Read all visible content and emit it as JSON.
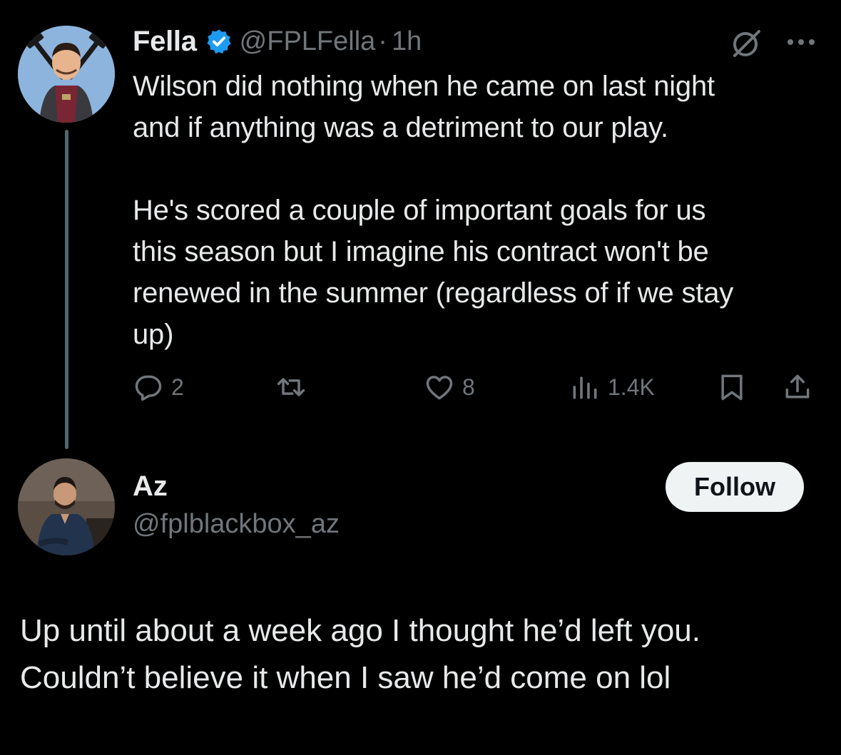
{
  "parent_tweet": {
    "display_name": "Fella",
    "handle": "@FPLFella",
    "separator": "·",
    "time": "1h",
    "text_lines": [
      "Wilson did nothing when he came on last night",
      "and if anything was a detriment to our play."
    ],
    "text_lines_2": [
      "He's scored a couple of important goals for us",
      "this season but I imagine his contract won't be",
      "renewed in the summer (regardless of if we stay",
      "up)"
    ],
    "stats": {
      "replies": "2",
      "retweets": "",
      "likes": "8",
      "views": "1.4K"
    }
  },
  "reply_tweet": {
    "display_name": "Az",
    "handle": "@fplblackbox_az",
    "follow_label": "Follow",
    "text_lines": [
      "Up until about a week ago I thought he’d left you.",
      "Couldn’t believe it when I saw he’d come on lol"
    ]
  },
  "colors": {
    "background": "#000000",
    "primary_text": "#e7e9ea",
    "secondary_text": "#71767b",
    "verified": "#1d9bf0",
    "follow_bg": "#eff3f4"
  },
  "icons": {
    "verified": "verified-badge-icon",
    "grok": "grok-icon",
    "more": "more-dots-icon",
    "reply": "reply-icon",
    "retweet": "retweet-icon",
    "like": "heart-icon",
    "views": "views-chart-icon",
    "bookmark": "bookmark-icon",
    "share": "share-icon"
  }
}
